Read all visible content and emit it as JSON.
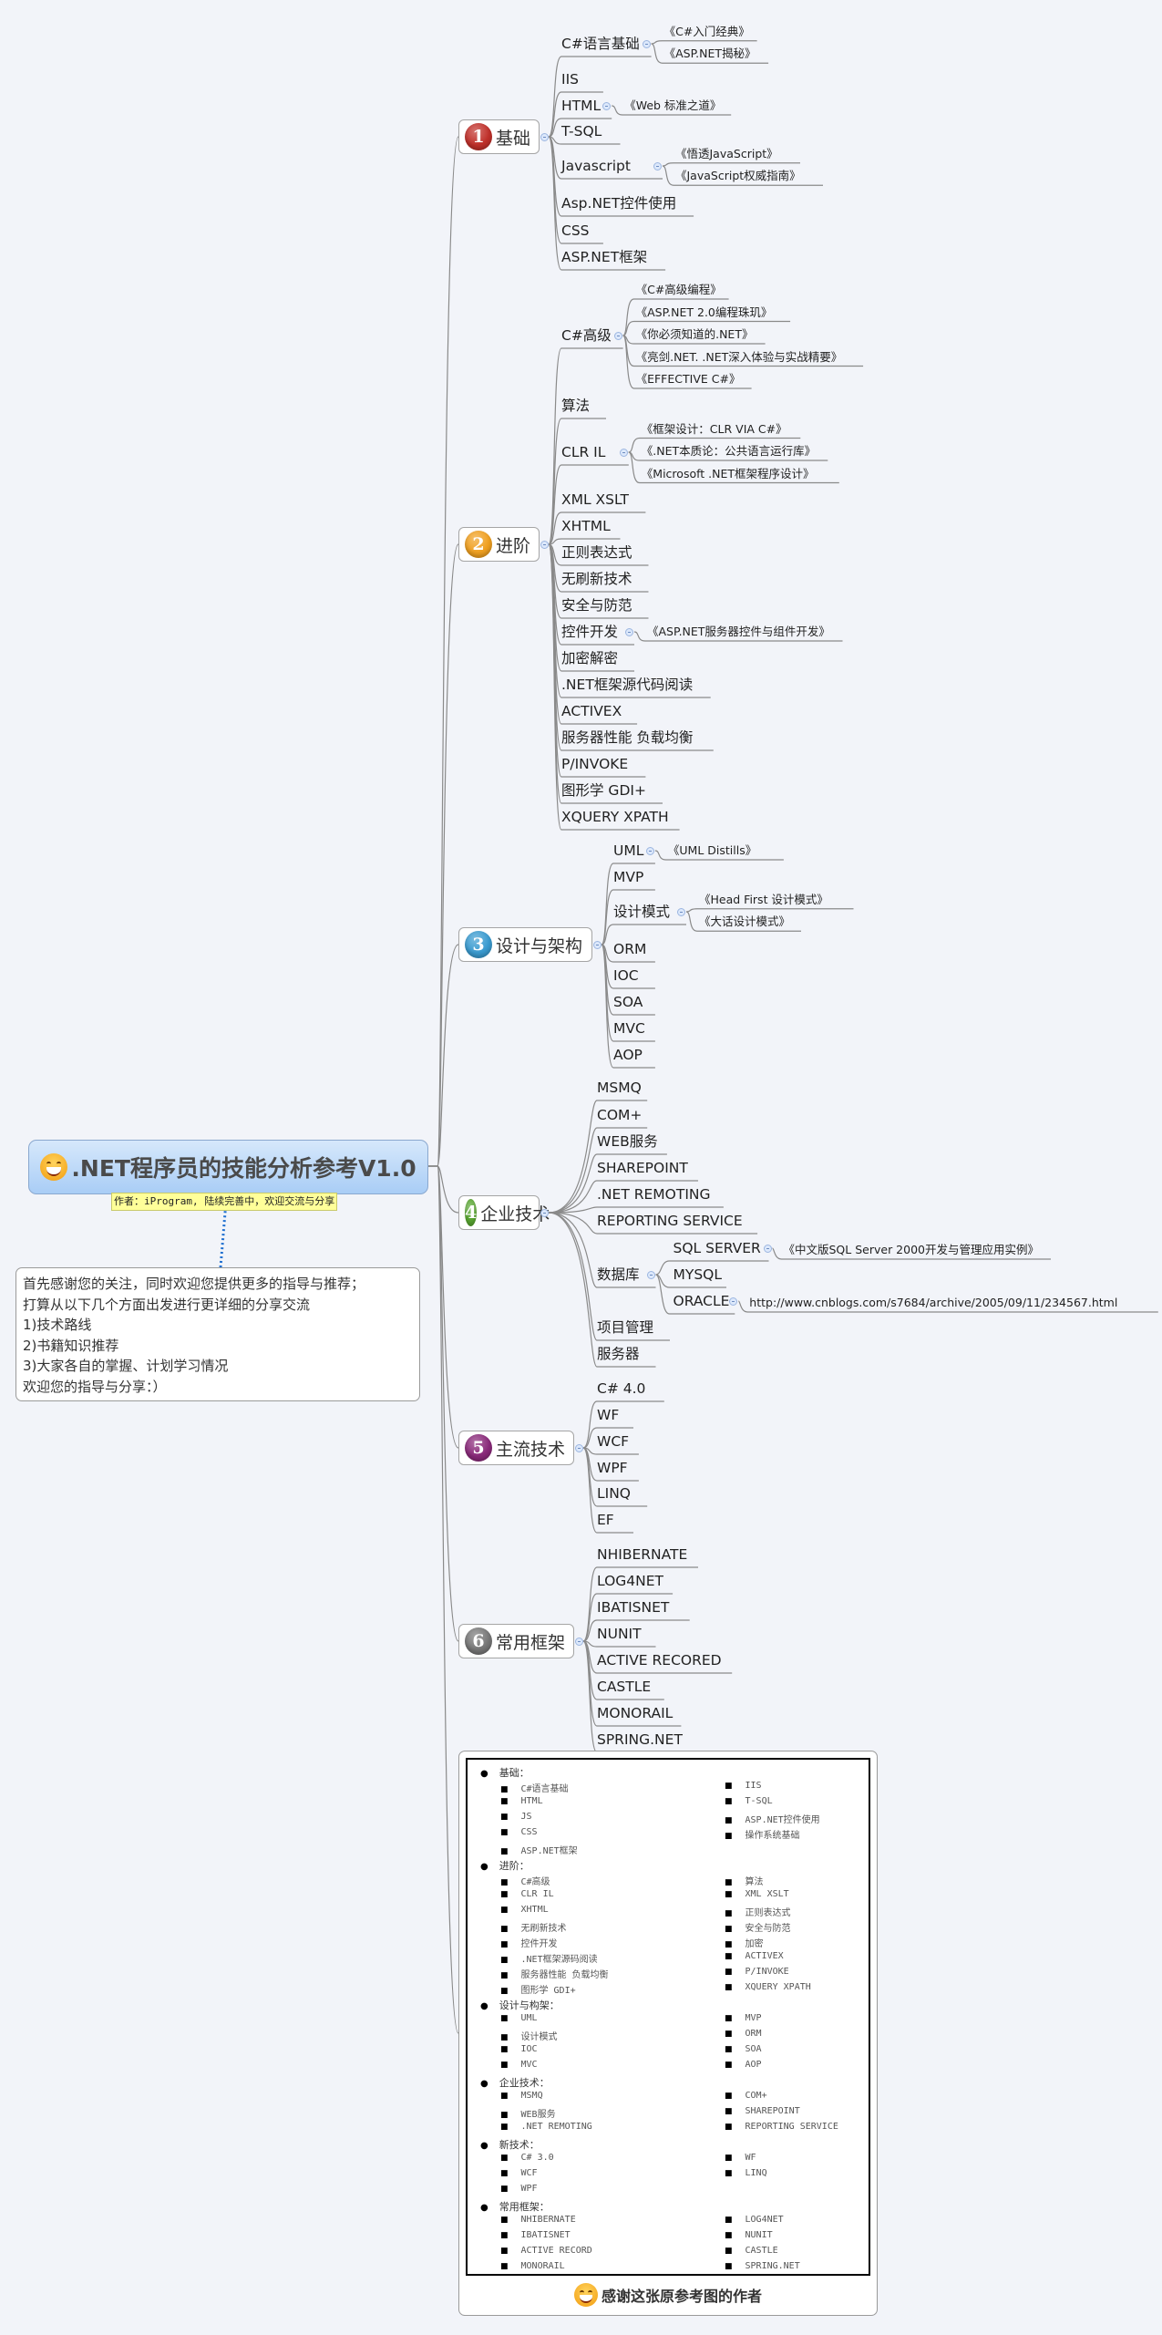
{
  "central": {
    "title": ".NET程序员的技能分析参考V1.0",
    "icon": "smiley-icon"
  },
  "author_note": "作者：iProgram, 陆续完善中，欢迎交流与分享",
  "intro_note": {
    "lines": [
      "首先感谢您的关注，同时欢迎您提供更多的指导与推荐；",
      "打算从以下几个方面出发进行更详细的分享交流",
      "1)技术路线",
      "2)书籍知识推荐",
      "3)大家各自的掌握、计划学习情况",
      "欢迎您的指导与分享：）"
    ]
  },
  "branches": [
    {
      "number": "1",
      "label": "基础",
      "color": "#c0302a",
      "children": [
        {
          "label": "C#语言基础",
          "books": [
            "《C#入门经典》",
            "《ASP.NET揭秘》"
          ]
        },
        {
          "label": "IIS"
        },
        {
          "label": "HTML",
          "books": [
            "《Web 标准之道》"
          ]
        },
        {
          "label": "T-SQL"
        },
        {
          "label": "Javascript",
          "books": [
            "《悟透JavaScript》",
            "《JavaScript权威指南》"
          ]
        },
        {
          "label": "Asp.NET控件使用"
        },
        {
          "label": "CSS"
        },
        {
          "label": "ASP.NET框架"
        }
      ]
    },
    {
      "number": "2",
      "label": "进阶",
      "color": "#f0a020",
      "children": [
        {
          "label": "C#高级",
          "books": [
            "《C#高级编程》",
            "《ASP.NET 2.0编程珠玑》",
            "《你必须知道的.NET》",
            "《亮剑.NET. .NET深入体验与实战精要》",
            "《EFFECTIVE C#》"
          ]
        },
        {
          "label": "算法"
        },
        {
          "label": "CLR IL",
          "books": [
            "《框架设计：CLR VIA C#》",
            "《.NET本质论：公共语言运行库》",
            "《Microsoft .NET框架程序设计》"
          ]
        },
        {
          "label": "XML XSLT"
        },
        {
          "label": "XHTML"
        },
        {
          "label": "正则表达式"
        },
        {
          "label": "无刷新技术"
        },
        {
          "label": "安全与防范"
        },
        {
          "label": "控件开发",
          "books": [
            "《ASP.NET服务器控件与组件开发》"
          ]
        },
        {
          "label": "加密解密"
        },
        {
          "label": ".NET框架源代码阅读"
        },
        {
          "label": "ACTIVEX"
        },
        {
          "label": "服务器性能 负载均衡"
        },
        {
          "label": "P/INVOKE"
        },
        {
          "label": "图形学 GDI+"
        },
        {
          "label": "XQUERY XPATH"
        }
      ]
    },
    {
      "number": "3",
      "label": "设计与架构",
      "color": "#3a9bd0",
      "children": [
        {
          "label": "UML",
          "books": [
            "《UML Distills》"
          ]
        },
        {
          "label": "MVP"
        },
        {
          "label": "设计模式",
          "books": [
            "《Head First 设计模式》",
            "《大话设计模式》"
          ]
        },
        {
          "label": "ORM"
        },
        {
          "label": "IOC"
        },
        {
          "label": "SOA"
        },
        {
          "label": "MVC"
        },
        {
          "label": "AOP"
        }
      ]
    },
    {
      "number": "4",
      "label": "企业技术",
      "color": "#5aa832",
      "children": [
        {
          "label": "MSMQ"
        },
        {
          "label": "COM+"
        },
        {
          "label": "WEB服务"
        },
        {
          "label": "SHAREPOINT"
        },
        {
          "label": ".NET REMOTING"
        },
        {
          "label": "REPORTING SERVICE"
        },
        {
          "label": "数据库",
          "subs": [
            {
              "label": "SQL SERVER",
              "books": [
                "《中文版SQL Server 2000开发与管理应用实例》"
              ]
            },
            {
              "label": "MYSQL"
            },
            {
              "label": "ORACLE",
              "books": [
                "http://www.cnblogs.com/s7684/archive/2005/09/11/234567.html"
              ]
            }
          ]
        },
        {
          "label": "项目管理"
        },
        {
          "label": "服务器"
        }
      ]
    },
    {
      "number": "5",
      "label": "主流技术",
      "color": "#8a2a7a",
      "children": [
        {
          "label": "C# 4.0"
        },
        {
          "label": "WF"
        },
        {
          "label": "WCF"
        },
        {
          "label": "WPF"
        },
        {
          "label": "LINQ"
        },
        {
          "label": "EF"
        }
      ]
    },
    {
      "number": "6",
      "label": "常用框架",
      "color": "#777777",
      "children": [
        {
          "label": "NHIBERNATE"
        },
        {
          "label": "LOG4NET"
        },
        {
          "label": "IBATISNET"
        },
        {
          "label": "NUNIT"
        },
        {
          "label": "ACTIVE RECORED"
        },
        {
          "label": "CASTLE"
        },
        {
          "label": "MONORAIL"
        },
        {
          "label": "SPRING.NET"
        }
      ]
    }
  ],
  "reference_image": {
    "sections": [
      {
        "title": "基础：",
        "left": [
          "C#语言基础",
          "HTML",
          "JS",
          "CSS",
          "ASP.NET框架"
        ],
        "right": [
          "IIS",
          "T-SQL",
          "ASP.NET控件使用",
          "操作系统基础"
        ]
      },
      {
        "title": "进阶：",
        "left": [
          "C#高级",
          "CLR IL",
          "XHTML",
          "无刷新技术",
          "控件开发",
          ".NET框架源码阅读",
          "服务器性能 负载均衡",
          "图形学 GDI+"
        ],
        "right": [
          "算法",
          "XML XSLT",
          "正则表达式",
          "安全与防范",
          "加密",
          "ACTIVEX",
          "P/INVOKE",
          "XQUERY XPATH"
        ]
      },
      {
        "title": "设计与构架：",
        "left": [
          "UML",
          "设计模式",
          "IOC",
          "MVC"
        ],
        "right": [
          "MVP",
          "ORM",
          "SOA",
          "AOP"
        ]
      },
      {
        "title": "企业技术：",
        "left": [
          "MSMQ",
          "WEB服务",
          ".NET REMOTING"
        ],
        "right": [
          "COM+",
          "SHAREPOINT",
          "REPORTING SERVICE"
        ]
      },
      {
        "title": "新技术：",
        "left": [
          "C# 3.0",
          "WCF",
          "WPF"
        ],
        "right": [
          "WF",
          "LINQ"
        ]
      },
      {
        "title": "常用框架：",
        "left": [
          "NHIBERNATE",
          "IBATISNET",
          "ACTIVE RECORD",
          "MONORAIL"
        ],
        "right": [
          "LOG4NET",
          "NUNIT",
          "CASTLE",
          "SPRING.NET"
        ]
      }
    ],
    "caption": "感谢这张原参考图的作者"
  }
}
